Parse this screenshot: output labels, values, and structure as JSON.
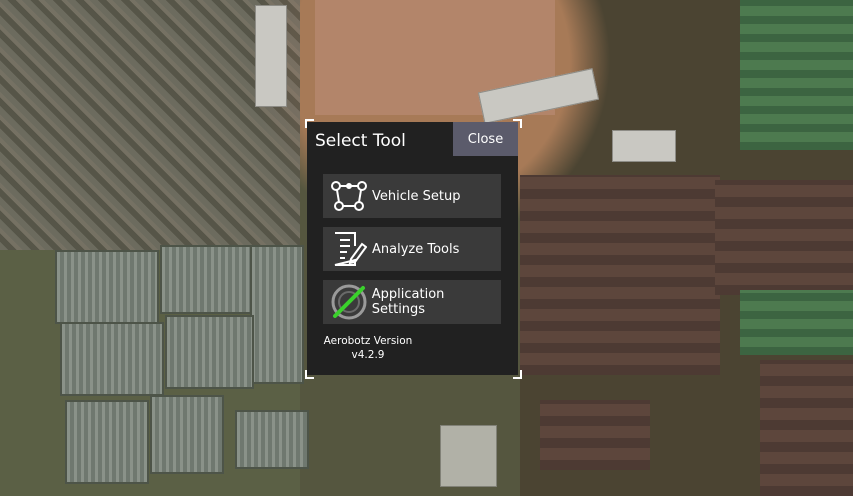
{
  "dialog": {
    "title": "Select Tool",
    "close_label": "Close",
    "tools": [
      {
        "label": "Vehicle Setup",
        "icon": "vehicle-setup-icon"
      },
      {
        "label": "Analyze Tools",
        "icon": "analyze-tools-icon"
      },
      {
        "label": "Application Settings",
        "icon": "application-settings-icon"
      }
    ],
    "version_name": "Aerobotz Version",
    "version_number": "v4.2.9"
  },
  "colors": {
    "dialog_bg": "#212121",
    "button_bg": "#3a3a3a",
    "close_bg": "#5b5b6b",
    "accent_green": "#3ad12c"
  }
}
